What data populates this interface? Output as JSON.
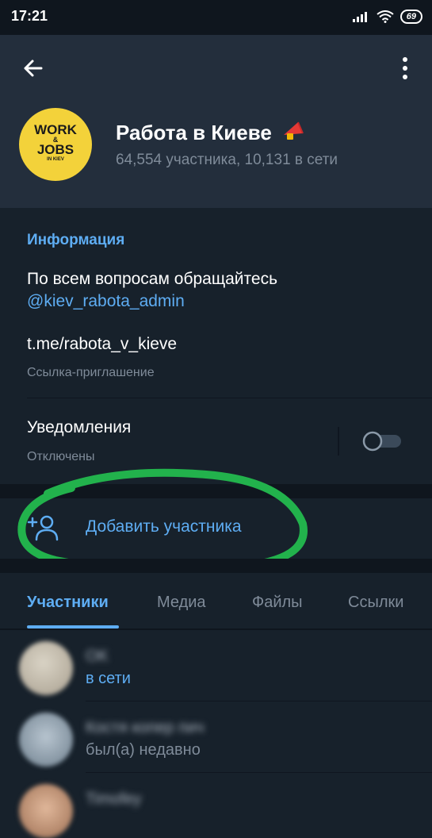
{
  "status_bar": {
    "time": "17:21",
    "battery": "69"
  },
  "channel": {
    "title": "Работа в Киеве",
    "subtitle": "64,554 участника, 10,131 в сети",
    "avatar_lines": [
      "WORK",
      "&",
      "JOBS",
      "IN KIEV"
    ]
  },
  "info": {
    "section_title": "Информация",
    "description": "По всем вопросам обращайтесь",
    "mention": "@kiev_rabota_admin",
    "link": "t.me/rabota_v_kieve",
    "link_caption": "Ссылка-приглашение",
    "notifications_label": "Уведомления",
    "notifications_status": "Отключены"
  },
  "add_member": {
    "label": "Добавить участника"
  },
  "tabs": [
    {
      "label": "Участники"
    },
    {
      "label": "Медиа"
    },
    {
      "label": "Файлы"
    },
    {
      "label": "Ссылки"
    }
  ],
  "members": [
    {
      "name": "OK",
      "status": "в сети"
    },
    {
      "name": "Костя копер пич",
      "status": "был(а) недавно"
    },
    {
      "name": "Timofey",
      "status": ""
    }
  ],
  "colors": {
    "accent": "#5eadf3",
    "header_bg": "#232e3c",
    "page_bg": "#17212b",
    "highlight_ring": "#22b24c"
  }
}
